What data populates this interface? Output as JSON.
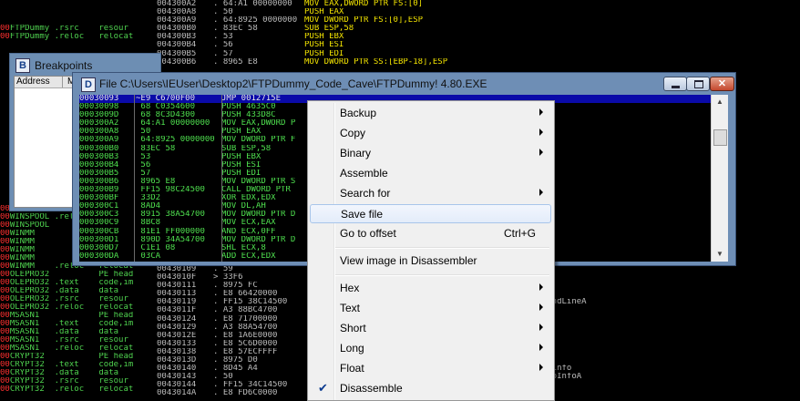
{
  "bg_left_rows": [
    {
      "mark": "",
      "text": ""
    },
    {
      "mark": "",
      "text": ""
    },
    {
      "mark": "",
      "text": ""
    },
    {
      "mark": "00",
      "text": "FTPDummy .rsrc    resour"
    },
    {
      "mark": "00",
      "text": "FTPDummy .reloc   relocat"
    },
    {
      "mark": "",
      "text": ""
    },
    {
      "mark": "",
      "text": ""
    },
    {
      "mark": "",
      "text": ""
    },
    {
      "mark": "",
      "text": ""
    },
    {
      "mark": "",
      "text": ""
    },
    {
      "mark": "",
      "text": ""
    },
    {
      "mark": "",
      "text": ""
    },
    {
      "mark": "",
      "text": ""
    },
    {
      "mark": "",
      "text": ""
    },
    {
      "mark": "",
      "text": ""
    },
    {
      "mark": "",
      "text": ""
    },
    {
      "mark": "",
      "text": ""
    },
    {
      "mark": "",
      "text": ""
    },
    {
      "mark": "",
      "text": ""
    },
    {
      "mark": "",
      "text": ""
    },
    {
      "mark": "",
      "text": ""
    },
    {
      "mark": "",
      "text": ""
    },
    {
      "mark": "",
      "text": ""
    },
    {
      "mark": "",
      "text": ""
    },
    {
      "mark": "",
      "text": ""
    },
    {
      "mark": "00",
      "text": "WINSPOOL .rsrc    resour"
    },
    {
      "mark": "00",
      "text": "WINSPOOL .reloc   relocat"
    },
    {
      "mark": "00",
      "text": "WINSPOOL"
    },
    {
      "mark": "00",
      "text": "WINMM"
    },
    {
      "mark": "00",
      "text": "WINMM"
    },
    {
      "mark": "00",
      "text": "WINMM"
    },
    {
      "mark": "00",
      "text": "WINMM"
    },
    {
      "mark": "00",
      "text": "WINMM    .reloc   relocat"
    },
    {
      "mark": "00",
      "text": "OLEPRO32          PE head"
    },
    {
      "mark": "00",
      "text": "OLEPRO32 .text    code,im"
    },
    {
      "mark": "00",
      "text": "OLEPRO32 .data    data"
    },
    {
      "mark": "00",
      "text": "OLEPRO32 .rsrc    resour"
    },
    {
      "mark": "00",
      "text": "OLEPRO32 .reloc   relocat"
    },
    {
      "mark": "00",
      "text": "MSASN1            PE head"
    },
    {
      "mark": "00",
      "text": "MSASN1   .text    code,im"
    },
    {
      "mark": "00",
      "text": "MSASN1   .data    data"
    },
    {
      "mark": "00",
      "text": "MSASN1   .rsrc    resour"
    },
    {
      "mark": "00",
      "text": "MSASN1   .reloc   relocat"
    },
    {
      "mark": "00",
      "text": "CRYPT32           PE head"
    },
    {
      "mark": "00",
      "text": "CRYPT32  .text    code,im"
    },
    {
      "mark": "00",
      "text": "CRYPT32  .data    data"
    },
    {
      "mark": "00",
      "text": "CRYPT32  .rsrc    resour"
    },
    {
      "mark": "00",
      "text": "CRYPT32  .reloc   relocat"
    }
  ],
  "bg_right_rows": [
    {
      "addr": "004300A2",
      "hex": ". 64:A1 00000000",
      "asm": "MOV EAX,DWORD PTR FS:[0]",
      "cmt": ""
    },
    {
      "addr": "004300A8",
      "hex": ". 50",
      "asm": "PUSH EAX",
      "cmt": ""
    },
    {
      "addr": "004300A9",
      "hex": ". 64:8925 0000000",
      "asm": "MOV DWORD PTR FS:[0],ESP",
      "cmt": ""
    },
    {
      "addr": "004300B0",
      "hex": ". 83EC 58",
      "asm": "SUB ESP,58",
      "cmt": ""
    },
    {
      "addr": "004300B3",
      "hex": ". 53",
      "asm": "PUSH EBX",
      "cmt": ""
    },
    {
      "addr": "004300B4",
      "hex": ". 56",
      "asm": "PUSH ESI",
      "cmt": ""
    },
    {
      "addr": "004300B5",
      "hex": ". 57",
      "asm": "PUSH EDI",
      "cmt": ""
    },
    {
      "addr": "004300B6",
      "hex": ". 8965 E8",
      "asm": "MOV DWORD PTR SS:[EBP-18],ESP",
      "cmt": ""
    },
    {
      "addr": "",
      "hex": "",
      "asm": "",
      "cmt": ""
    },
    {
      "addr": "",
      "hex": "",
      "asm": "",
      "cmt": ""
    },
    {
      "addr": "",
      "hex": "",
      "asm": "",
      "cmt": ""
    },
    {
      "addr": "",
      "hex": "",
      "asm": "",
      "cmt": ""
    },
    {
      "addr": "",
      "hex": "",
      "asm": "",
      "cmt": ""
    },
    {
      "addr": "",
      "hex": "",
      "asm": "",
      "cmt": ""
    },
    {
      "addr": "",
      "hex": "",
      "asm": "",
      "cmt": ""
    },
    {
      "addr": "",
      "hex": "",
      "asm": "",
      "cmt": ""
    },
    {
      "addr": "",
      "hex": "",
      "asm": "",
      "cmt": ""
    },
    {
      "addr": "",
      "hex": "",
      "asm": "",
      "cmt": ""
    },
    {
      "addr": "",
      "hex": "",
      "asm": "",
      "cmt": ""
    },
    {
      "addr": "",
      "hex": "",
      "asm": "",
      "cmt": ""
    },
    {
      "addr": "",
      "hex": "",
      "asm": "",
      "cmt": ""
    },
    {
      "addr": "",
      "hex": "",
      "asm": "",
      "cmt": ""
    },
    {
      "addr": "",
      "hex": "",
      "asm": "",
      "cmt": ""
    },
    {
      "addr": "",
      "hex": "",
      "asm": "",
      "cmt": ""
    },
    {
      "addr": "",
      "hex": "",
      "asm": "",
      "cmt": ""
    },
    {
      "addr": "",
      "hex": "",
      "asm": "",
      "cmt": ""
    },
    {
      "addr": "",
      "hex": "",
      "asm": "",
      "cmt": ""
    },
    {
      "addr": "",
      "hex": "",
      "asm": "",
      "cmt": ""
    },
    {
      "addr": "",
      "hex": "",
      "asm": "",
      "cmt": ""
    },
    {
      "addr": "",
      "hex": "",
      "asm": "",
      "cmt": ""
    },
    {
      "addr": "",
      "hex": "",
      "asm": "",
      "cmt": ""
    },
    {
      "addr": "",
      "hex": "",
      "asm": "",
      "cmt": ""
    },
    {
      "addr": "00430109",
      "hex": ". 59",
      "asm": "",
      "cmt": ""
    },
    {
      "addr": "0043010F",
      "hex": "> 33F6",
      "asm": "",
      "cmt": ""
    },
    {
      "addr": "00430111",
      "hex": ". 8975 FC",
      "asm": "",
      "cmt": ""
    },
    {
      "addr": "00430113",
      "hex": ". E8 66420000",
      "asm": "",
      "cmt": ""
    },
    {
      "addr": "00430119",
      "hex": ". FF15 38C14500",
      "asm": "",
      "cmt": "ommandLineA"
    },
    {
      "addr": "0043011F",
      "hex": ". A3 88BC4700",
      "asm": "",
      "cmt": ""
    },
    {
      "addr": "00430124",
      "hex": ". E8 71700000",
      "asm": "",
      "cmt": ""
    },
    {
      "addr": "00430129",
      "hex": ". A3 88A54700",
      "asm": "",
      "cmt": ""
    },
    {
      "addr": "0043012E",
      "hex": ". E8 1A6E0000",
      "asm": "",
      "cmt": ""
    },
    {
      "addr": "00430133",
      "hex": ". E8 5C6D0000",
      "asm": "",
      "cmt": ""
    },
    {
      "addr": "00430138",
      "hex": ". E8 57ECFFFF",
      "asm": "",
      "cmt": ""
    },
    {
      "addr": "0043013D",
      "hex": ". 8975 D0",
      "asm": "",
      "cmt": ""
    },
    {
      "addr": "00430140",
      "hex": ". 8D45 A4",
      "asm": "",
      "cmt": "rtupinfo"
    },
    {
      "addr": "00430143",
      "hex": ". 50",
      "asm": "",
      "cmt": "artupInfoA"
    },
    {
      "addr": "00430144",
      "hex": ". FF15 34C14500",
      "asm": "",
      "cmt": ""
    },
    {
      "addr": "0043014A",
      "hex": ". E8 FD6C0000",
      "asm": "",
      "cmt": ""
    }
  ],
  "breakpoints": {
    "icon": "B",
    "title": "Breakpoints",
    "col_address": "Address",
    "col_m": "M"
  },
  "file_window": {
    "icon": "D",
    "title": "File C:\\Users\\IEUser\\Desktop2\\FTPDummy_Code_Cave\\FTPDummy! 4.80.EXE",
    "rows": [
      {
        "a": "00030093",
        "h": "~E9 C6700F00",
        "i": "JMP 0012715E"
      },
      {
        "a": "00030098",
        "h": " 68 C0354600",
        "i": "PUSH 4635C0"
      },
      {
        "a": "0003009D",
        "h": " 68 8C3D4300",
        "i": "PUSH 433D8C"
      },
      {
        "a": "000300A2",
        "h": " 64:A1 00000000",
        "i": "MOV EAX,DWORD P"
      },
      {
        "a": "000300A8",
        "h": " 50",
        "i": "PUSH EAX"
      },
      {
        "a": "000300A9",
        "h": " 64:8925 0000000",
        "i": "MOV DWORD PTR F"
      },
      {
        "a": "000300B0",
        "h": " 83EC 58",
        "i": "SUB ESP,58"
      },
      {
        "a": "000300B3",
        "h": " 53",
        "i": "PUSH EBX"
      },
      {
        "a": "000300B4",
        "h": " 56",
        "i": "PUSH ESI"
      },
      {
        "a": "000300B5",
        "h": " 57",
        "i": "PUSH EDI"
      },
      {
        "a": "000300B6",
        "h": " 8965 E8",
        "i": "MOV DWORD PTR S"
      },
      {
        "a": "000300B9",
        "h": " FF15 98C24500",
        "i": "CALL DWORD PTR"
      },
      {
        "a": "000300BF",
        "h": " 33D2",
        "i": "XOR EDX,EDX"
      },
      {
        "a": "000300C1",
        "h": " 8AD4",
        "i": "MOV DL,AH"
      },
      {
        "a": "000300C3",
        "h": " 8915 38A54700",
        "i": "MOV DWORD PTR D"
      },
      {
        "a": "000300C9",
        "h": " 8BC8",
        "i": "MOV ECX,EAX"
      },
      {
        "a": "000300CB",
        "h": " 81E1 FF000000",
        "i": "AND ECX,0FF"
      },
      {
        "a": "000300D1",
        "h": " 890D 34A54700",
        "i": "MOV DWORD PTR D"
      },
      {
        "a": "000300D7",
        "h": " C1E1 08",
        "i": "SHL ECX,8"
      },
      {
        "a": "000300DA",
        "h": " 03CA",
        "i": "ADD ECX,EDX"
      }
    ]
  },
  "scrollbar": {
    "up_arrow": "▲",
    "down_arrow": "▼"
  },
  "context_menu": {
    "items": [
      {
        "label": "Backup",
        "shortcut": "",
        "submenu": true,
        "checked": false,
        "highlighted": false,
        "sep_after": false
      },
      {
        "label": "Copy",
        "shortcut": "",
        "submenu": true,
        "checked": false,
        "highlighted": false,
        "sep_after": false
      },
      {
        "label": "Binary",
        "shortcut": "",
        "submenu": true,
        "checked": false,
        "highlighted": false,
        "sep_after": false
      },
      {
        "label": "Assemble",
        "shortcut": "",
        "submenu": false,
        "checked": false,
        "highlighted": false,
        "sep_after": false
      },
      {
        "label": "Search for",
        "shortcut": "",
        "submenu": true,
        "checked": false,
        "highlighted": false,
        "sep_after": false
      },
      {
        "label": "Save file",
        "shortcut": "",
        "submenu": false,
        "checked": false,
        "highlighted": true,
        "sep_after": false
      },
      {
        "label": "Go to offset",
        "shortcut": "Ctrl+G",
        "submenu": false,
        "checked": false,
        "highlighted": false,
        "sep_after": true
      },
      {
        "label": "View image in Disassembler",
        "shortcut": "",
        "submenu": false,
        "checked": false,
        "highlighted": false,
        "sep_after": true
      },
      {
        "label": "Hex",
        "shortcut": "",
        "submenu": true,
        "checked": false,
        "highlighted": false,
        "sep_after": false
      },
      {
        "label": "Text",
        "shortcut": "",
        "submenu": true,
        "checked": false,
        "highlighted": false,
        "sep_after": false
      },
      {
        "label": "Short",
        "shortcut": "",
        "submenu": true,
        "checked": false,
        "highlighted": false,
        "sep_after": false
      },
      {
        "label": "Long",
        "shortcut": "",
        "submenu": true,
        "checked": false,
        "highlighted": false,
        "sep_after": false
      },
      {
        "label": "Float",
        "shortcut": "",
        "submenu": true,
        "checked": false,
        "highlighted": false,
        "sep_after": false
      },
      {
        "label": "Disassemble",
        "shortcut": "",
        "submenu": false,
        "checked": true,
        "highlighted": false,
        "sep_after": false
      }
    ]
  },
  "colors": {
    "code_green": "#4fe04f",
    "asm_yellow": "#f2e300",
    "selection_blue": "#0a0aa8",
    "title_blue": "#6e8eb5"
  }
}
